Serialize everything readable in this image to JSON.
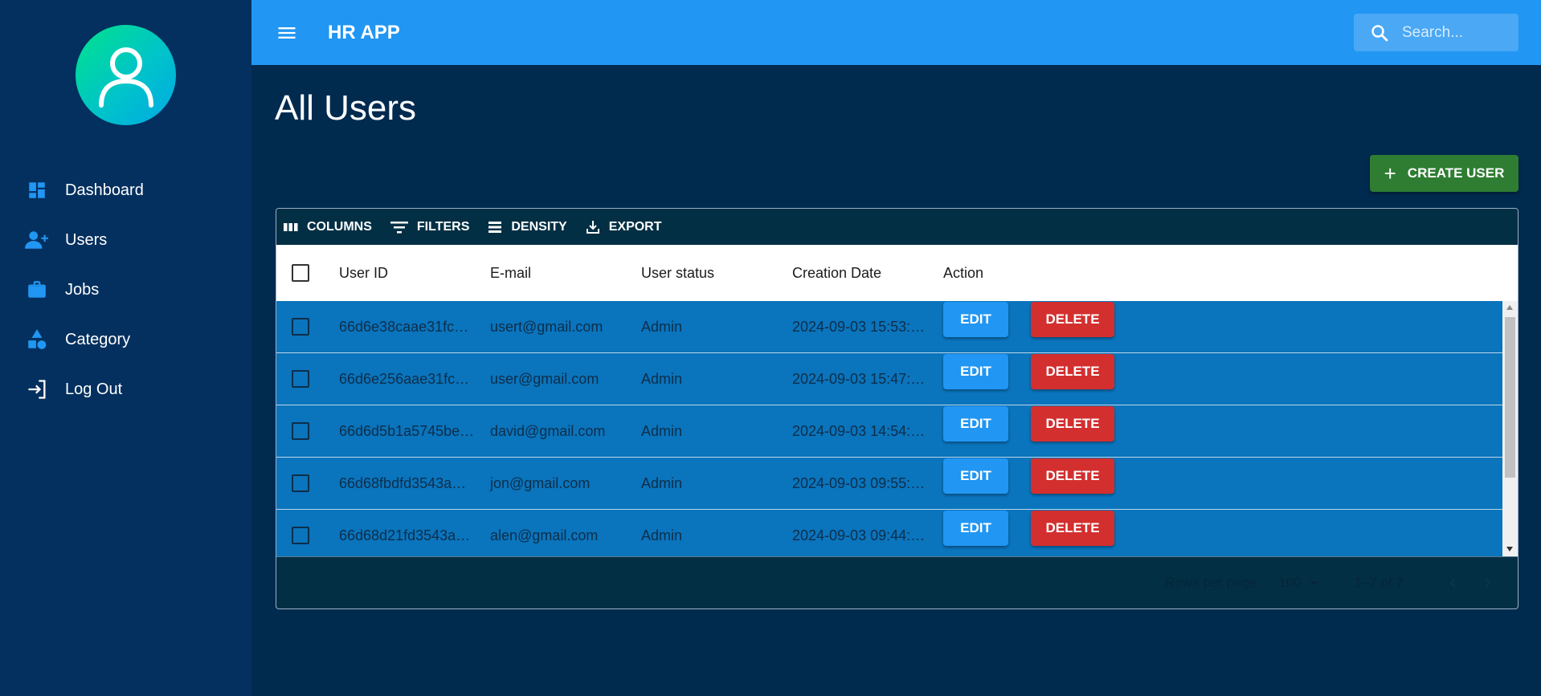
{
  "app": {
    "title": "HR APP"
  },
  "search": {
    "placeholder": "Search..."
  },
  "sidebar": {
    "items": [
      {
        "label": "Dashboard",
        "icon": "dashboard-icon"
      },
      {
        "label": "Users",
        "icon": "person-add-icon"
      },
      {
        "label": "Jobs",
        "icon": "briefcase-icon"
      },
      {
        "label": "Category",
        "icon": "category-icon"
      },
      {
        "label": "Log Out",
        "icon": "logout-icon"
      }
    ]
  },
  "main": {
    "title": "All Users",
    "create_label": "CREATE USER"
  },
  "toolbar": {
    "columns": "COLUMNS",
    "filters": "FILTERS",
    "density": "DENSITY",
    "export": "EXPORT"
  },
  "table": {
    "headers": {
      "id": "User ID",
      "email": "E-mail",
      "status": "User status",
      "date": "Creation Date",
      "action": "Action"
    },
    "rows": [
      {
        "id": "66d6e38caae31fc…",
        "email": "usert@gmail.com",
        "status": "Admin",
        "date": "2024-09-03 15:53:…"
      },
      {
        "id": "66d6e256aae31fc…",
        "email": "user@gmail.com",
        "status": "Admin",
        "date": "2024-09-03 15:47:…"
      },
      {
        "id": "66d6d5b1a5745be…",
        "email": "david@gmail.com",
        "status": "Admin",
        "date": "2024-09-03 14:54:…"
      },
      {
        "id": "66d68fbdfd3543a…",
        "email": "jon@gmail.com",
        "status": "Admin",
        "date": "2024-09-03 09:55:…"
      },
      {
        "id": "66d68d21fd3543a…",
        "email": "alen@gmail.com",
        "status": "Admin",
        "date": "2024-09-03 09:44:…"
      }
    ],
    "edit_label": "EDIT",
    "delete_label": "DELETE"
  },
  "footer": {
    "rows_per_page_label": "Rows per page:",
    "rows_per_page_value": "100",
    "range": "1–7 of 7"
  },
  "colors": {
    "header": "#2196f3",
    "sidebar": "#03305f",
    "background": "#012a4f",
    "row": "#0a74bc",
    "create": "#2e7d32",
    "delete": "#d32f2f"
  }
}
